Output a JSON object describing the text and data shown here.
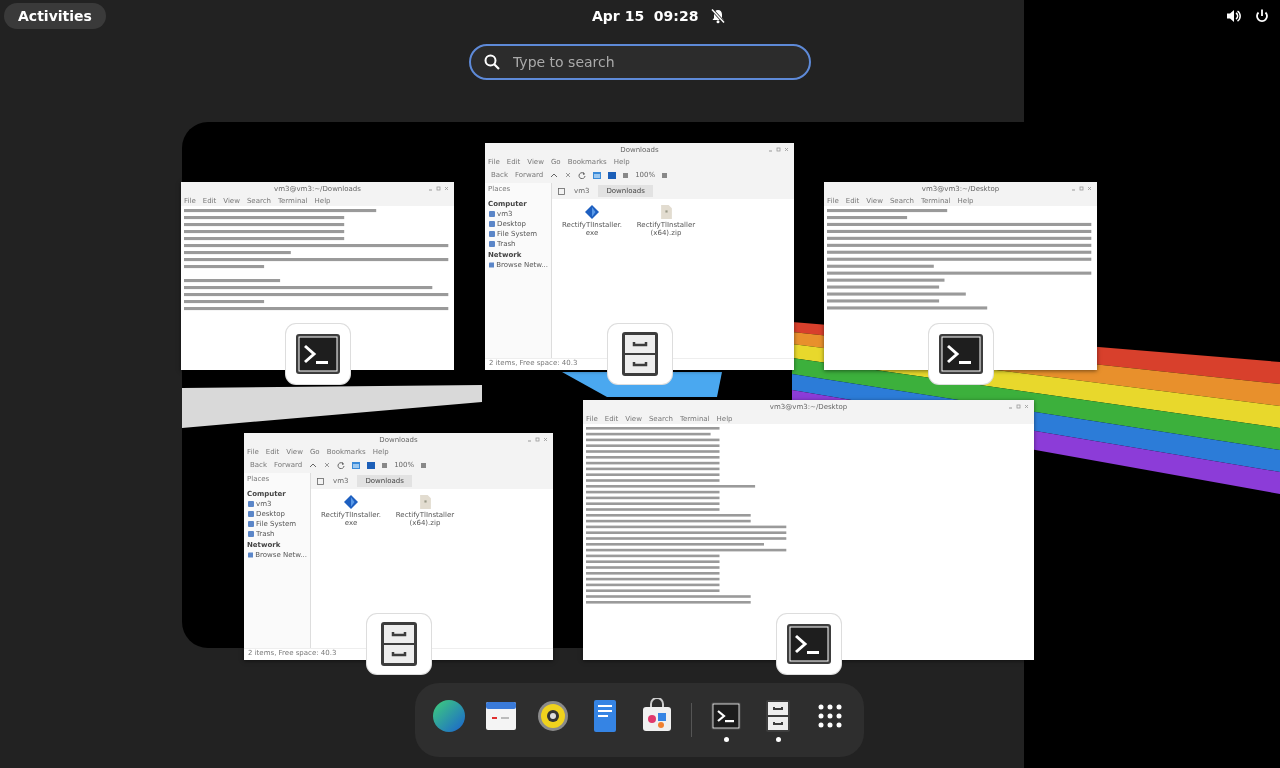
{
  "top_bar": {
    "activities": "Activities",
    "clock": "Apr 15  09:28",
    "notifications_muted": true
  },
  "search": {
    "placeholder": "Type to search"
  },
  "windows": [
    {
      "kind": "terminal",
      "title": "vm3@vm3:~/Downloads",
      "menu": [
        "File",
        "Edit",
        "View",
        "Search",
        "Terminal",
        "Help"
      ]
    },
    {
      "kind": "files",
      "title": "Downloads",
      "menu": [
        "File",
        "Edit",
        "View",
        "Go",
        "Bookmarks",
        "Help"
      ],
      "back": "Back",
      "forward": "Forward",
      "zoom": "100%",
      "places": "Places",
      "sidebar": [
        {
          "heading": "Computer",
          "items": [
            "vm3",
            "Desktop",
            "File System",
            "Trash"
          ]
        },
        {
          "heading": "Network",
          "items": [
            "Browse Netw..."
          ]
        }
      ],
      "path": [
        {
          "label": "vm3",
          "selected": false
        },
        {
          "label": "Downloads",
          "selected": true
        }
      ],
      "files": [
        {
          "kind": "exe",
          "name": "RectifyTlInstaller.exe"
        },
        {
          "kind": "zip",
          "name": "RectifyTlInstaller(x64).zip"
        }
      ],
      "status": "2 items, Free space: 40.3"
    },
    {
      "kind": "terminal",
      "title": "vm3@vm3:~/Desktop",
      "menu": [
        "File",
        "Edit",
        "View",
        "Search",
        "Terminal",
        "Help"
      ]
    },
    {
      "kind": "files",
      "title": "Downloads",
      "menu": [
        "File",
        "Edit",
        "View",
        "Go",
        "Bookmarks",
        "Help"
      ],
      "back": "Back",
      "forward": "Forward",
      "zoom": "100%",
      "places": "Places",
      "sidebar": [
        {
          "heading": "Computer",
          "items": [
            "vm3",
            "Desktop",
            "File System",
            "Trash"
          ]
        },
        {
          "heading": "Network",
          "items": [
            "Browse Netw..."
          ]
        }
      ],
      "path": [
        {
          "label": "vm3",
          "selected": false
        },
        {
          "label": "Downloads",
          "selected": true
        }
      ],
      "files": [
        {
          "kind": "exe",
          "name": "RectifyTlInstaller.exe"
        },
        {
          "kind": "zip",
          "name": "RectifyTlInstaller(x64).zip"
        }
      ],
      "status": "2 items, Free space: 40.3"
    },
    {
      "kind": "terminal",
      "title": "vm3@vm3:~/Desktop",
      "menu": [
        "File",
        "Edit",
        "View",
        "Search",
        "Terminal",
        "Help"
      ]
    }
  ],
  "dock": [
    {
      "kind": "browser",
      "running": false
    },
    {
      "kind": "calendar",
      "running": false
    },
    {
      "kind": "music",
      "running": false
    },
    {
      "kind": "editor",
      "running": false
    },
    {
      "kind": "software",
      "running": false
    },
    {
      "kind": "separator"
    },
    {
      "kind": "terminal",
      "running": true
    },
    {
      "kind": "files",
      "running": true
    },
    {
      "kind": "grid",
      "running": false
    }
  ]
}
